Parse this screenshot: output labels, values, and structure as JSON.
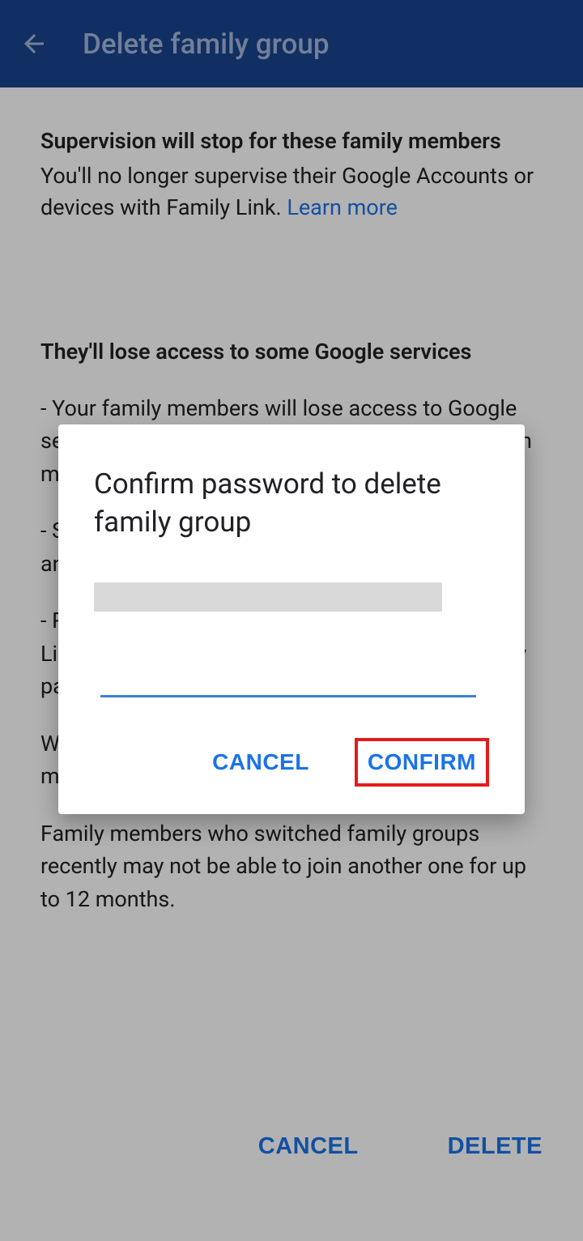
{
  "header": {
    "title": "Delete family group"
  },
  "main": {
    "section1": {
      "heading": "Supervision will stop for these family members",
      "text": "You'll no longer supervise their Google Accounts or devices with Family Link. ",
      "learn_more": "Learn more"
    },
    "section2": {
      "heading": "They'll lose access to some Google services",
      "item1": "- Your family members will lose access to Google services shared as part of your family group. Learn more",
      "item2": "- Supervised family members won't be able to use any apps you've approved for them.",
      "item3": "- Purchases made through Google Play Family Library stay with the family member who originally paid.",
      "note1": "When your family group is deleted, your family members will be notified by email.",
      "note2": "Family members who switched family groups recently may not be able to join another one for up to 12 months."
    }
  },
  "actions": {
    "cancel": "CANCEL",
    "delete": "DELETE"
  },
  "dialog": {
    "title": "Confirm password to delete family group",
    "cancel": "CANCEL",
    "confirm": "CONFIRM",
    "password_value": ""
  }
}
